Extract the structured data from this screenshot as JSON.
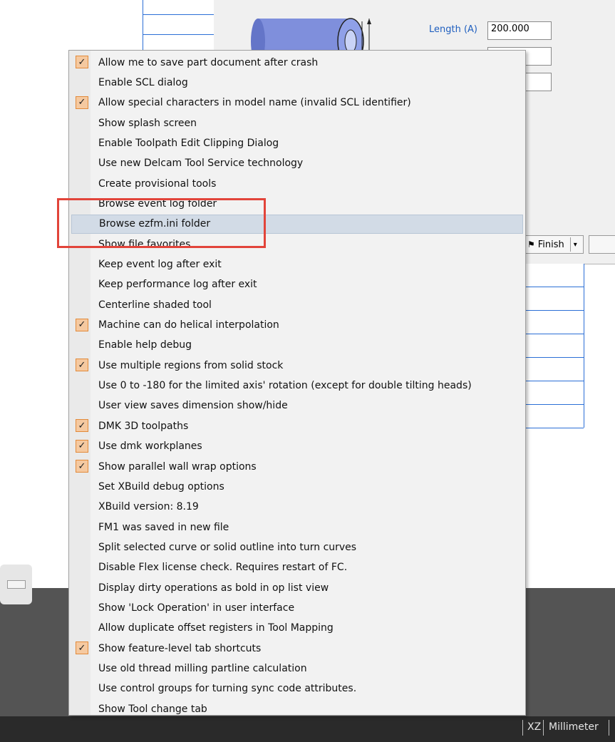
{
  "dialog": {
    "length_label": "Length (A)",
    "length_value": "200.000",
    "finish_label": "Finish",
    "finish_mnemonic": "F"
  },
  "menu": {
    "items": [
      {
        "label": "Allow me to save part document after crash",
        "checked": true
      },
      {
        "label": "Enable SCL dialog",
        "checked": false
      },
      {
        "label": "Allow special characters in model name (invalid SCL identifier)",
        "checked": true
      },
      {
        "label": "Show splash screen",
        "checked": false
      },
      {
        "label": "Enable Toolpath Edit Clipping Dialog",
        "checked": false
      },
      {
        "label": "Use new Delcam Tool Service technology",
        "checked": false
      },
      {
        "label": "Create provisional tools",
        "checked": false
      },
      {
        "label": "Browse event log folder",
        "checked": false
      },
      {
        "label": "Browse ezfm.ini folder",
        "checked": false,
        "highlighted": true
      },
      {
        "label": "Show file favorites",
        "checked": false
      },
      {
        "label": "Keep event log after exit",
        "checked": false
      },
      {
        "label": "Keep performance log after exit",
        "checked": false
      },
      {
        "label": "Centerline shaded tool",
        "checked": false
      },
      {
        "label": "Machine can do helical interpolation",
        "checked": true
      },
      {
        "label": "Enable help debug",
        "checked": false
      },
      {
        "label": "Use multiple regions from solid stock",
        "checked": true
      },
      {
        "label": "Use 0 to -180 for the limited axis' rotation (except for double tilting heads)",
        "checked": false
      },
      {
        "label": "User view saves dimension show/hide",
        "checked": false
      },
      {
        "label": "DMK 3D toolpaths",
        "checked": true
      },
      {
        "label": "Use dmk workplanes",
        "checked": true
      },
      {
        "label": "Show parallel wall wrap options",
        "checked": true
      },
      {
        "label": "Set XBuild debug options",
        "checked": false
      },
      {
        "label": "XBuild version: 8.19",
        "checked": false
      },
      {
        "label": "FM1 was saved in new file",
        "checked": false
      },
      {
        "label": "Split selected curve or solid outline into turn curves",
        "checked": false
      },
      {
        "label": "Disable Flex license check.  Requires restart of FC.",
        "checked": false
      },
      {
        "label": "Display dirty operations as bold in op list view",
        "checked": false
      },
      {
        "label": "Show 'Lock Operation' in user interface",
        "checked": false
      },
      {
        "label": "Allow duplicate offset registers in Tool Mapping",
        "checked": false
      },
      {
        "label": "Show feature-level tab shortcuts",
        "checked": true
      },
      {
        "label": "Use old thread milling partline calculation",
        "checked": false
      },
      {
        "label": "Use control groups for turning sync code attributes.",
        "checked": false
      },
      {
        "label": "Show Tool change tab",
        "checked": false
      }
    ]
  },
  "status_bar": {
    "plane": "XZ",
    "units": "Millimeter"
  },
  "colors": {
    "highlight": "#d2dbe6",
    "annotation": "#e2443a",
    "check_fill": "#f5c9a0",
    "check_border": "#e28a3a"
  },
  "icons": {
    "check": "checkmark-icon",
    "finish": "checkered-flag-icon",
    "dropdown": "chevron-down-icon"
  }
}
